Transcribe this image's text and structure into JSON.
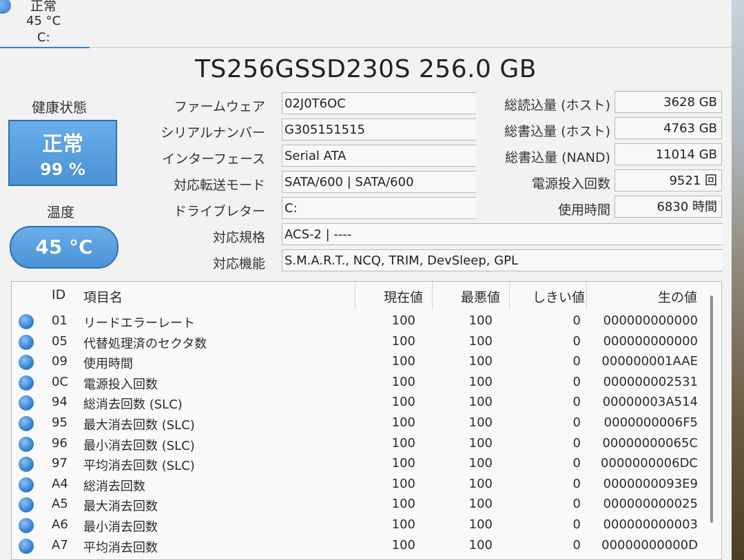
{
  "drive_tab": {
    "status": "正常",
    "temperature": "45 °C",
    "letter": "C:"
  },
  "title": "TS256GSSD230S 256.0 GB",
  "health": {
    "label": "健康状態",
    "status": "正常",
    "percent": "99 %"
  },
  "temperature": {
    "label": "温度",
    "value": "45 °C"
  },
  "info": {
    "firmware": {
      "label": "ファームウェア",
      "value": "02J0T6OC"
    },
    "serial": {
      "label": "シリアルナンバー",
      "value": "G305151515"
    },
    "interface": {
      "label": "インターフェース",
      "value": "Serial ATA"
    },
    "transfer_mode": {
      "label": "対応転送モード",
      "value": "SATA/600 | SATA/600"
    },
    "drive_letter": {
      "label": "ドライブレター",
      "value": "C:"
    },
    "standard": {
      "label": "対応規格",
      "value": "ACS-2 | ----"
    },
    "features": {
      "label": "対応機能",
      "value": "S.M.A.R.T., NCQ, TRIM, DevSleep, GPL"
    }
  },
  "stats": {
    "host_reads": {
      "label": "総読込量 (ホスト)",
      "value": "3628 GB"
    },
    "host_writes": {
      "label": "総書込量 (ホスト)",
      "value": "4763 GB"
    },
    "nand_writes": {
      "label": "総書込量 (NAND)",
      "value": "11014 GB"
    },
    "power_on_count": {
      "label": "電源投入回数",
      "value": "9521 回"
    },
    "power_on_hours": {
      "label": "使用時間",
      "value": "6830 時間"
    }
  },
  "smart": {
    "headers": {
      "id": "ID",
      "name": "項目名",
      "current": "現在値",
      "worst": "最悪値",
      "threshold": "しきい値",
      "raw": "生の値"
    },
    "rows": [
      {
        "id": "01",
        "name": "リードエラーレート",
        "current": "100",
        "worst": "100",
        "threshold": "0",
        "raw": "000000000000"
      },
      {
        "id": "05",
        "name": "代替処理済のセクタ数",
        "current": "100",
        "worst": "100",
        "threshold": "0",
        "raw": "000000000000"
      },
      {
        "id": "09",
        "name": "使用時間",
        "current": "100",
        "worst": "100",
        "threshold": "0",
        "raw": "000000001AAE"
      },
      {
        "id": "0C",
        "name": "電源投入回数",
        "current": "100",
        "worst": "100",
        "threshold": "0",
        "raw": "000000002531"
      },
      {
        "id": "94",
        "name": "総消去回数 (SLC)",
        "current": "100",
        "worst": "100",
        "threshold": "0",
        "raw": "00000003A514"
      },
      {
        "id": "95",
        "name": "最大消去回数 (SLC)",
        "current": "100",
        "worst": "100",
        "threshold": "0",
        "raw": "0000000006F5"
      },
      {
        "id": "96",
        "name": "最小消去回数 (SLC)",
        "current": "100",
        "worst": "100",
        "threshold": "0",
        "raw": "00000000065C"
      },
      {
        "id": "97",
        "name": "平均消去回数 (SLC)",
        "current": "100",
        "worst": "100",
        "threshold": "0",
        "raw": "0000000006DC"
      },
      {
        "id": "A4",
        "name": "総消去回数",
        "current": "100",
        "worst": "100",
        "threshold": "0",
        "raw": "0000000093E9"
      },
      {
        "id": "A5",
        "name": "最大消去回数",
        "current": "100",
        "worst": "100",
        "threshold": "0",
        "raw": "000000000025"
      },
      {
        "id": "A6",
        "name": "最小消去回数",
        "current": "100",
        "worst": "100",
        "threshold": "0",
        "raw": "000000000003"
      },
      {
        "id": "A7",
        "name": "平均消去回数",
        "current": "100",
        "worst": "100",
        "threshold": "0",
        "raw": "00000000000D"
      }
    ]
  },
  "colors": {
    "accent": "#4a93d6",
    "good_dot": "#3b86d6"
  }
}
